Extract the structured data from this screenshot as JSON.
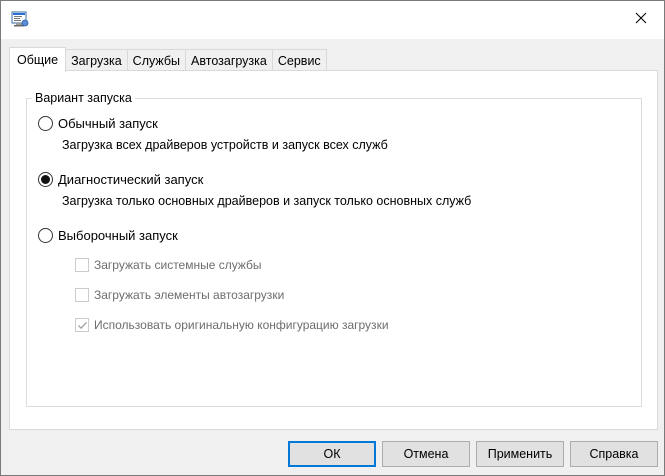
{
  "tabs": [
    {
      "label": "Общие"
    },
    {
      "label": "Загрузка"
    },
    {
      "label": "Службы"
    },
    {
      "label": "Автозагрузка"
    },
    {
      "label": "Сервис"
    }
  ],
  "group": {
    "legend": "Вариант запуска"
  },
  "options": {
    "normal": {
      "label": "Обычный запуск",
      "description": "Загрузка всех драйверов устройств и запуск всех служб"
    },
    "diagnostic": {
      "label": "Диагностический запуск",
      "description": "Загрузка только основных драйверов и запуск только основных служб"
    },
    "selective": {
      "label": "Выборочный запуск"
    }
  },
  "selected_option": "diagnostic",
  "checkboxes": {
    "system_services": {
      "label": "Загружать системные службы",
      "checked": false
    },
    "startup_items": {
      "label": "Загружать элементы автозагрузки",
      "checked": false
    },
    "original_config": {
      "label": "Использовать оригинальную конфигурацию загрузки",
      "checked": true
    }
  },
  "buttons": {
    "ok": "ОК",
    "cancel": "Отмена",
    "apply": "Применить",
    "help": "Справка"
  },
  "icons": {
    "app": "system-config-icon",
    "close": "close-icon"
  },
  "colors": {
    "accent": "#0078d7",
    "panel_bg": "#ffffff",
    "window_bg": "#f0f0f0"
  }
}
